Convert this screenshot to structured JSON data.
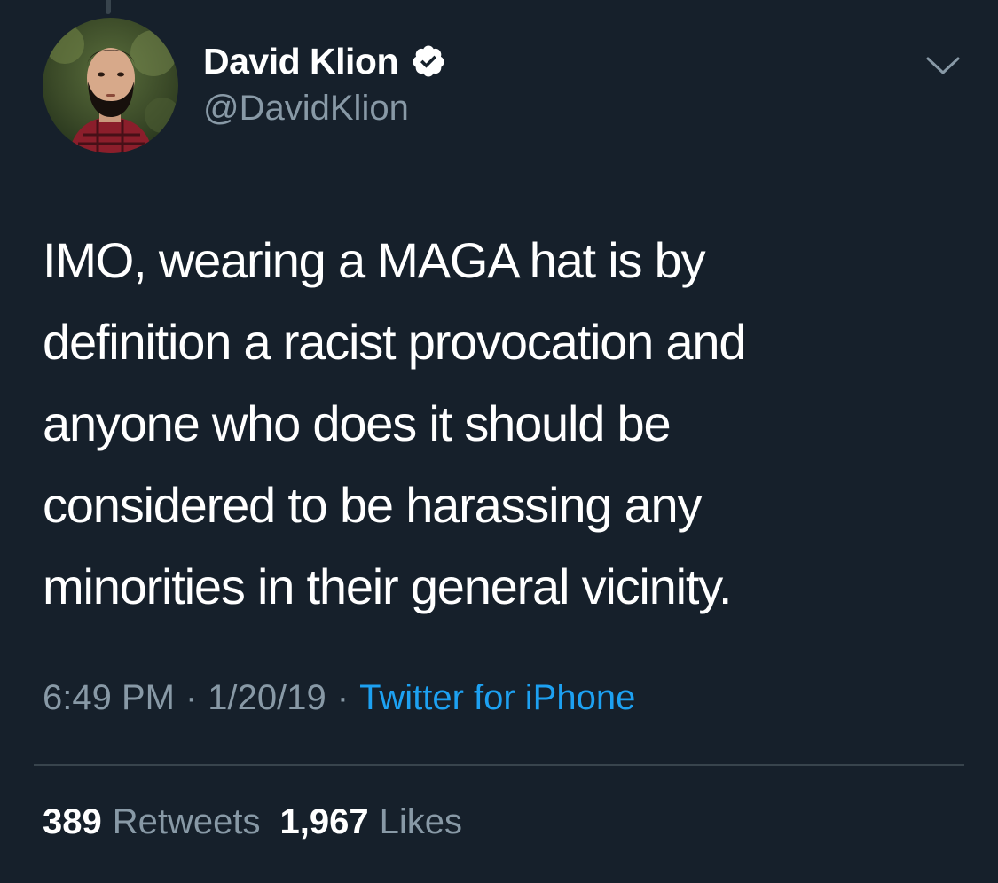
{
  "tweet": {
    "author": {
      "display_name": "David Klion",
      "handle": "@DavidKlion",
      "verified": true,
      "verified_icon": "verified-badge-icon",
      "avatar": "profile-photo"
    },
    "menu_icon": "chevron-down-icon",
    "text": "IMO, wearing a MAGA hat is by\ndefinition a racist provocation and\nanyone who does it should be\nconsidered to be harassing any\nminorities in their general vicinity.",
    "time": "6:49 PM",
    "separator": "·",
    "date": "1/20/19",
    "source": "Twitter for iPhone",
    "stats": {
      "retweets_count": "389",
      "retweets_label": "Retweets",
      "likes_count": "1,967",
      "likes_label": "Likes"
    }
  },
  "colors": {
    "background": "#16202b",
    "text_primary": "#ffffff",
    "text_secondary": "#8899a6",
    "link": "#1da1f2",
    "divider": "#38444d"
  }
}
